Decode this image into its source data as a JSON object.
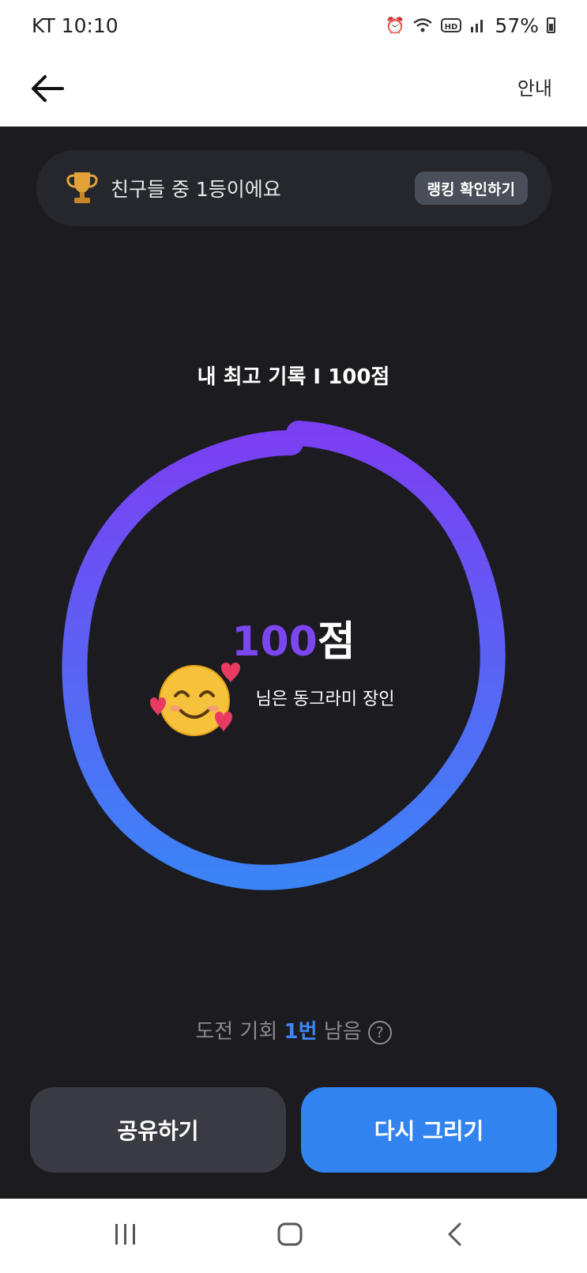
{
  "status_bar": {
    "carrier_time": "KT 10:10",
    "icons": [
      "alarm-icon",
      "wifi-icon",
      "hd-icon",
      "signal-icon"
    ],
    "battery": "57%"
  },
  "app_bar": {
    "back_icon": "arrow-left-icon",
    "guide_label": "안내"
  },
  "ranking": {
    "icon": "trophy-icon",
    "text": "친구들 중 1등이에요",
    "button_label": "랭킹 확인하기"
  },
  "best_record": "내 최고 기록 I 100점",
  "result": {
    "score_number": "100",
    "score_unit": "점",
    "title": "님은 동그라미 장인",
    "name_covered_by": "smiling-face-with-hearts-emoji"
  },
  "drawn_circle": {
    "gradient_top": "#7b3ff2",
    "gradient_bottom": "#3c83f6"
  },
  "chance": {
    "prefix": "도전 기회 ",
    "count": "1번",
    "suffix": " 남음",
    "help_icon": "question-circle-icon"
  },
  "actions": {
    "share_label": "공유하기",
    "retry_label": "다시 그리기"
  },
  "colors": {
    "background": "#1b1b20",
    "accent_blue": "#3183f0",
    "accent_purple": "#7b46f0"
  },
  "nav_bar": {
    "items": [
      "recent-apps-icon",
      "home-icon",
      "back-icon"
    ]
  }
}
